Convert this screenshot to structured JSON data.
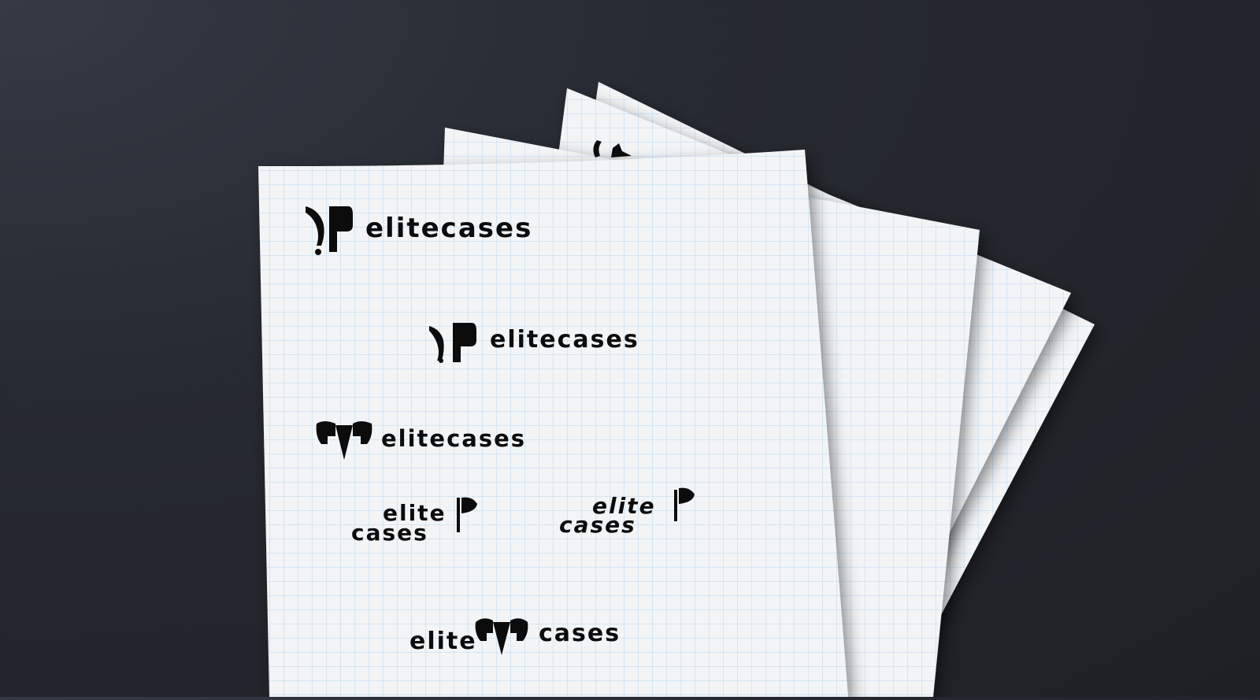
{
  "scene": {
    "background_color": "#262a31",
    "paper_color": "#f2f4f6",
    "grid_color": "#b7d6ef",
    "ink_color": "#0c0c0c"
  },
  "logos": [
    {
      "variant": "knife-axe mark + wordmark",
      "text": "elitecases"
    },
    {
      "variant": "knife-axe mark + wordmark (centered)",
      "text": "elitecases"
    },
    {
      "variant": "double-axe mark + wordmark",
      "text": "elitecases"
    },
    {
      "variant": "stacked wordmark + axe mark",
      "line1": "elite",
      "line2": "cases"
    },
    {
      "variant": "stacked italic wordmark + axe mark",
      "line1": "elite",
      "line2": "cases"
    },
    {
      "variant": "wordmark with central double-axe",
      "left": "elite",
      "right": "cases"
    }
  ]
}
